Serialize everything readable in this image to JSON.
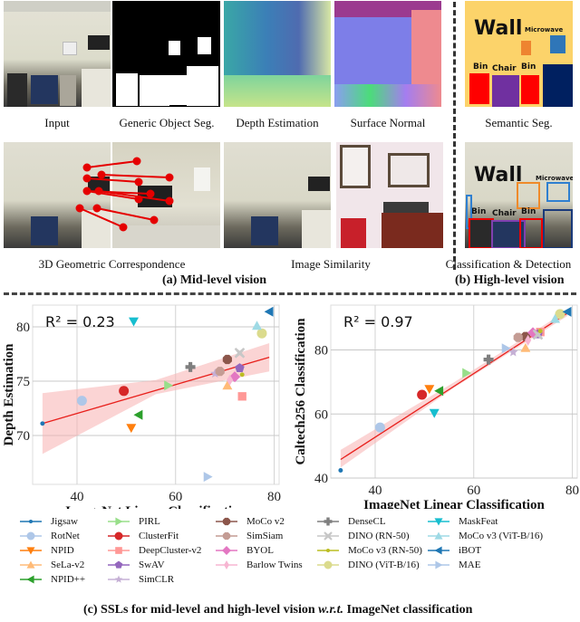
{
  "panel_a": {
    "images": [
      {
        "caption": "Input"
      },
      {
        "caption": "Generic Object Seg."
      },
      {
        "caption": "Depth Estimation"
      },
      {
        "caption": "Surface Normal"
      },
      {
        "caption": "3D Geometric Correspondence"
      },
      {
        "caption": "Image Similarity"
      }
    ],
    "subcaption": "(a) Mid-level vision"
  },
  "panel_b": {
    "images": [
      {
        "caption": "Semantic Seg.",
        "labels": [
          "Wall",
          "Microwave",
          "Bin",
          "Chair",
          "Bin"
        ]
      },
      {
        "caption": "Classification & Detection",
        "labels": [
          "Wall",
          "Microwave",
          "Bin",
          "Chair",
          "Bin"
        ]
      }
    ],
    "subcaption": "(b) High-level vision"
  },
  "panel_c": {
    "subcaption_prefix": "(c) SSLs for mid-level and high-level vision ",
    "subcaption_italic": "w.r.t.",
    "subcaption_suffix": " ImageNet classification"
  },
  "chart_data": [
    {
      "type": "scatter",
      "title": "",
      "annotation": "R² = 0.23",
      "xlabel": "ImageNet Linear Classification",
      "ylabel": "Depth Estimation",
      "xlim": [
        31,
        81
      ],
      "ylim": [
        65.5,
        82
      ],
      "xticks": [
        40,
        60,
        80
      ],
      "yticks": [
        70,
        75,
        80
      ],
      "grid": true,
      "regression": {
        "x0": 33,
        "y0": 71.1,
        "x1": 79,
        "y1": 77.2,
        "band": [
          [
            33,
            68.3,
            73.9
          ],
          [
            56,
            73.8,
            75.1
          ],
          [
            79,
            75.9,
            78.5
          ]
        ]
      },
      "points": [
        {
          "method": "Jigsaw",
          "x": 33,
          "y": 71.1
        },
        {
          "method": "RotNet",
          "x": 41,
          "y": 73.2
        },
        {
          "method": "NPID",
          "x": 51,
          "y": 70.7
        },
        {
          "method": "SeLa-v2",
          "x": 70.5,
          "y": 74.6
        },
        {
          "method": "NPID++",
          "x": 52.5,
          "y": 71.9
        },
        {
          "method": "PIRL",
          "x": 58.5,
          "y": 74.6
        },
        {
          "method": "ClusterFit",
          "x": 49.5,
          "y": 74.1
        },
        {
          "method": "DeepCluster-v2",
          "x": 73.5,
          "y": 73.6
        },
        {
          "method": "SwAV",
          "x": 73,
          "y": 76.2
        },
        {
          "method": "SimCLR",
          "x": 68,
          "y": 75.7
        },
        {
          "method": "MoCo v2",
          "x": 70.5,
          "y": 77.0
        },
        {
          "method": "SimSiam",
          "x": 69,
          "y": 75.9
        },
        {
          "method": "BYOL",
          "x": 72,
          "y": 75.4
        },
        {
          "method": "Barlow Twins",
          "x": 71,
          "y": 75.1
        },
        {
          "method": "DenseCL",
          "x": 63,
          "y": 76.3
        },
        {
          "method": "DINO (RN-50)",
          "x": 73,
          "y": 77.6
        },
        {
          "method": "MoCo v3 (RN-50)",
          "x": 73.5,
          "y": 75.6
        },
        {
          "method": "DINO (ViT-B/16)",
          "x": 77.5,
          "y": 79.4
        },
        {
          "method": "MaskFeat",
          "x": 51.5,
          "y": 80.5
        },
        {
          "method": "MoCo v3 (ViT-B/16)",
          "x": 76.5,
          "y": 80.1
        },
        {
          "method": "iBOT",
          "x": 79,
          "y": 81.4
        },
        {
          "method": "MAE",
          "x": 66.5,
          "y": 66.2
        }
      ]
    },
    {
      "type": "scatter",
      "title": "",
      "annotation": "R² = 0.97",
      "xlabel": "ImageNet Linear Classification",
      "ylabel": "Caltech256 Classification",
      "xlim": [
        31,
        81
      ],
      "ylim": [
        40,
        94
      ],
      "xticks": [
        40,
        60,
        80
      ],
      "yticks": [
        40,
        60,
        80
      ],
      "grid": true,
      "regression": {
        "x0": 33,
        "y0": 45.8,
        "x1": 79,
        "y1": 91.5,
        "band": [
          [
            33,
            43.3,
            48.8
          ],
          [
            56,
            68.2,
            69.9
          ],
          [
            79,
            90.6,
            92.4
          ]
        ]
      },
      "points": [
        {
          "method": "Jigsaw",
          "x": 33,
          "y": 42.4
        },
        {
          "method": "RotNet",
          "x": 41,
          "y": 55.8
        },
        {
          "method": "NPID",
          "x": 51,
          "y": 67.8
        },
        {
          "method": "SeLa-v2",
          "x": 70.5,
          "y": 80.6
        },
        {
          "method": "NPID++",
          "x": 53,
          "y": 67.2
        },
        {
          "method": "PIRL",
          "x": 58.5,
          "y": 72.8
        },
        {
          "method": "ClusterFit",
          "x": 49.5,
          "y": 66.0
        },
        {
          "method": "DeepCluster-v2",
          "x": 73.5,
          "y": 85.6
        },
        {
          "method": "SwAV",
          "x": 73,
          "y": 84.9
        },
        {
          "method": "SimCLR",
          "x": 68,
          "y": 79.3
        },
        {
          "method": "MoCo v2",
          "x": 70.5,
          "y": 84.2
        },
        {
          "method": "SimSiam",
          "x": 69,
          "y": 83.9
        },
        {
          "method": "BYOL",
          "x": 72,
          "y": 85.4
        },
        {
          "method": "Barlow Twins",
          "x": 71,
          "y": 83.0
        },
        {
          "method": "DenseCL",
          "x": 63,
          "y": 77.0
        },
        {
          "method": "DINO (RN-50)",
          "x": 73,
          "y": 84.8
        },
        {
          "method": "MoCo v3 (RN-50)",
          "x": 73.5,
          "y": 85.9
        },
        {
          "method": "DINO (ViT-B/16)",
          "x": 77.5,
          "y": 91.2
        },
        {
          "method": "MaskFeat",
          "x": 52,
          "y": 60.3
        },
        {
          "method": "MoCo v3 (ViT-B/16)",
          "x": 76.5,
          "y": 89.7
        },
        {
          "method": "iBOT",
          "x": 79,
          "y": 91.9
        },
        {
          "method": "MAE",
          "x": 66.5,
          "y": 80.5
        }
      ]
    }
  ],
  "legend": [
    {
      "label": "Jigsaw",
      "color": "#1f77b4",
      "marker": "dot"
    },
    {
      "label": "RotNet",
      "color": "#aec7e8",
      "marker": "circle"
    },
    {
      "label": "NPID",
      "color": "#ff7f0e",
      "marker": "tri-down"
    },
    {
      "label": "SeLa-v2",
      "color": "#ffbb78",
      "marker": "tri-up"
    },
    {
      "label": "NPID++",
      "color": "#2ca02c",
      "marker": "tri-left"
    },
    {
      "label": "PIRL",
      "color": "#98df8a",
      "marker": "tri-right"
    },
    {
      "label": "ClusterFit",
      "color": "#d62728",
      "marker": "circle"
    },
    {
      "label": "DeepCluster-v2",
      "color": "#ff9896",
      "marker": "square"
    },
    {
      "label": "SwAV",
      "color": "#9467bd",
      "marker": "pentagon"
    },
    {
      "label": "SimCLR",
      "color": "#c5b0d5",
      "marker": "star"
    },
    {
      "label": "MoCo v2",
      "color": "#8c564b",
      "marker": "octagon"
    },
    {
      "label": "SimSiam",
      "color": "#c49c94",
      "marker": "octagon"
    },
    {
      "label": "BYOL",
      "color": "#e377c2",
      "marker": "diamond"
    },
    {
      "label": "Barlow Twins",
      "color": "#f7b6d2",
      "marker": "thin-diamond"
    },
    {
      "label": "DenseCL",
      "color": "#7f7f7f",
      "marker": "plus"
    },
    {
      "label": "DINO (RN-50)",
      "color": "#c7c7c7",
      "marker": "x"
    },
    {
      "label": "MoCo v3 (RN-50)",
      "color": "#bcbd22",
      "marker": "dot"
    },
    {
      "label": "DINO (ViT-B/16)",
      "color": "#dbdb8d",
      "marker": "circle"
    },
    {
      "label": "MaskFeat",
      "color": "#17becf",
      "marker": "tri-down"
    },
    {
      "label": "MoCo v3 (ViT-B/16)",
      "color": "#9edae5",
      "marker": "tri-up"
    },
    {
      "label": "iBOT",
      "color": "#1f77b4",
      "marker": "tri-left"
    },
    {
      "label": "MAE",
      "color": "#aec7e8",
      "marker": "tri-right"
    }
  ]
}
